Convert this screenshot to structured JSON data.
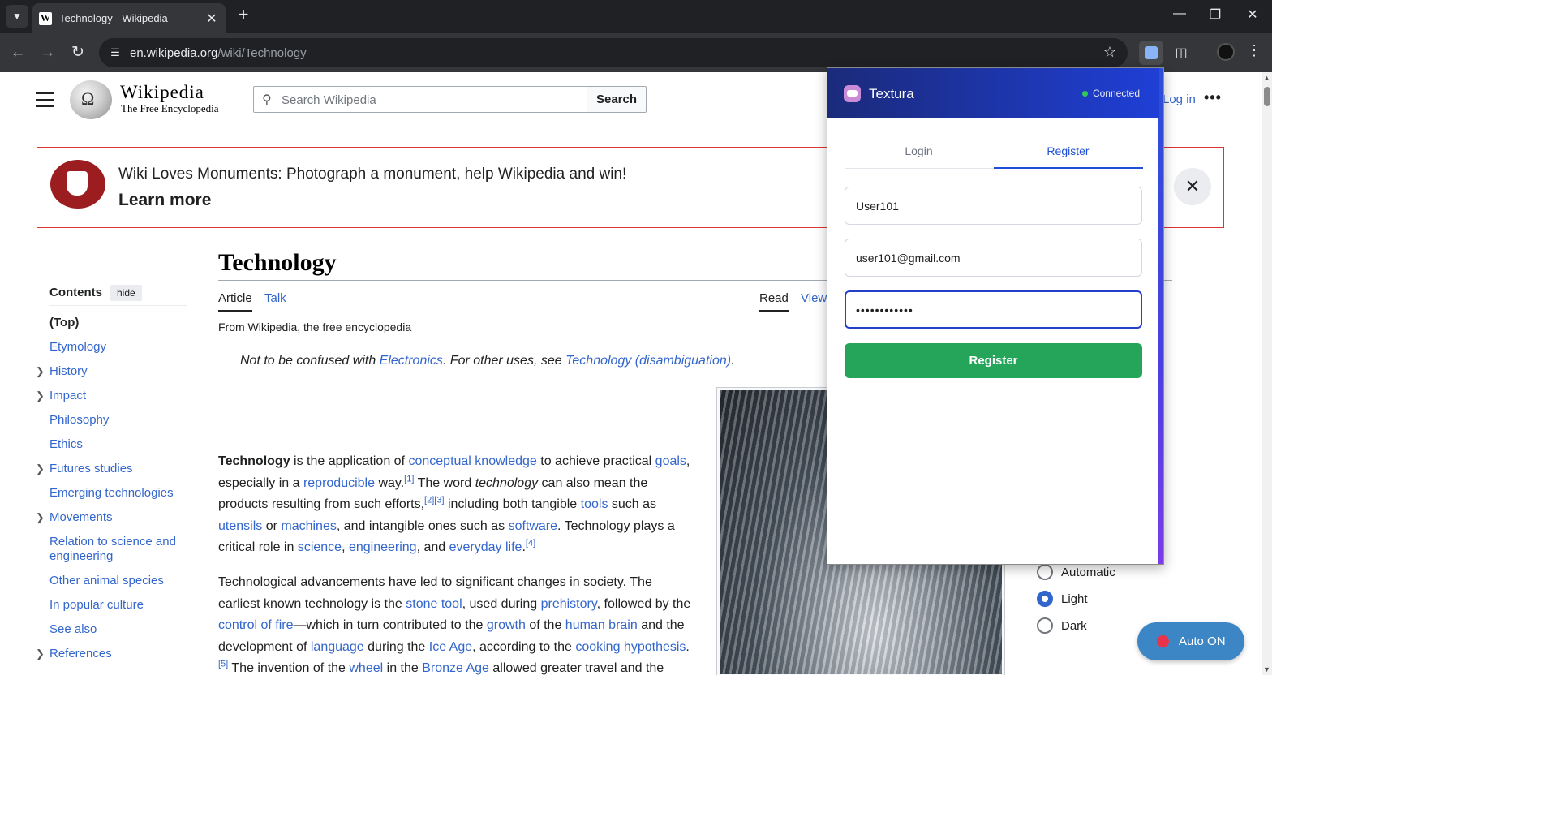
{
  "browser": {
    "tab": {
      "favicon": "W",
      "title": "Technology - Wikipedia"
    },
    "url": {
      "domain": "en.wikipedia.org",
      "path": "/wiki/Technology"
    },
    "icons": {
      "tab_search": "chevron-down-icon",
      "tab_close": "close-icon",
      "new_tab": "plus-icon",
      "minimize": "minimize-icon",
      "restore": "restore-icon",
      "close_window": "close-icon",
      "back": "back-arrow-icon",
      "forward": "forward-arrow-icon",
      "reload": "reload-icon",
      "site_info": "tune-icon",
      "bookmark": "star-icon",
      "extension": "textura-extension-icon",
      "extensions": "puzzle-icon",
      "profile": "profile-avatar",
      "menu": "kebab-menu-icon"
    }
  },
  "wikipedia": {
    "wordmark": "Wikipedia",
    "tagline": "The Free Encyclopedia",
    "search_placeholder": "Search Wikipedia",
    "search_button": "Search",
    "login": "Log in",
    "banner": {
      "message": "Wiki Loves Monuments: Photograph a monument, help Wikipedia and win!",
      "link": "Learn more"
    },
    "toc": {
      "title": "Contents",
      "hide": "hide",
      "items": [
        {
          "label": "(Top)",
          "expandable": false
        },
        {
          "label": "Etymology",
          "expandable": false
        },
        {
          "label": "History",
          "expandable": true
        },
        {
          "label": "Impact",
          "expandable": true
        },
        {
          "label": "Philosophy",
          "expandable": false
        },
        {
          "label": "Ethics",
          "expandable": false
        },
        {
          "label": "Futures studies",
          "expandable": true
        },
        {
          "label": "Emerging technologies",
          "expandable": false
        },
        {
          "label": "Movements",
          "expandable": true
        },
        {
          "label": "Relation to science and engineering",
          "expandable": false
        },
        {
          "label": "Other animal species",
          "expandable": false
        },
        {
          "label": "In popular culture",
          "expandable": false
        },
        {
          "label": "See also",
          "expandable": false
        },
        {
          "label": "References",
          "expandable": true
        }
      ]
    },
    "article": {
      "title": "Technology",
      "tabs": {
        "article": "Article",
        "talk": "Talk",
        "read": "Read",
        "view": "View"
      },
      "from": "From Wikipedia, the free encyclopedia",
      "hatnote": {
        "pre": "Not to be confused with ",
        "link1": "Electronics",
        "mid": ". For other uses, see ",
        "link2": "Technology (disambiguation)",
        "post": "."
      }
    },
    "appearance": {
      "options": [
        "Automatic",
        "Light",
        "Dark"
      ],
      "selected": "Light"
    }
  },
  "auto_button": {
    "label": "Auto ON"
  },
  "textura": {
    "name": "Textura",
    "status": "Connected",
    "tabs": {
      "login": "Login",
      "register": "Register"
    },
    "active_tab": "Register",
    "fields": {
      "username": "User101",
      "email": "user101@gmail.com",
      "password_masked": "••••••••••••"
    },
    "submit": "Register"
  }
}
